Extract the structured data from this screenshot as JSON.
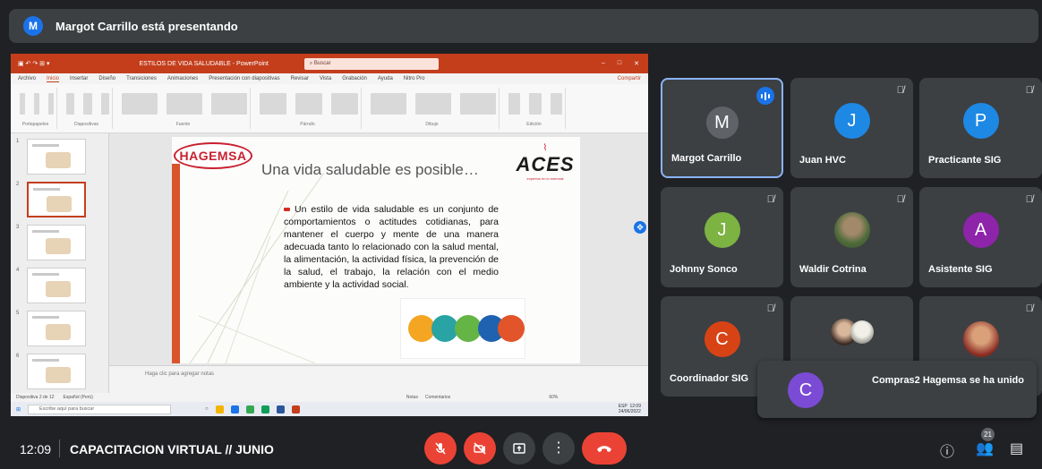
{
  "banner": {
    "avatar_letter": "M",
    "text": "Margot Carrillo está presentando",
    "avatar_color": "#1a73e8"
  },
  "presentation": {
    "window_title": "ESTILOS DE VIDA SALUDABLE - PowerPoint",
    "search_placeholder": "Buscar",
    "tabs": [
      "Archivo",
      "Inicio",
      "Insertar",
      "Diseño",
      "Transiciones",
      "Animaciones",
      "Presentación con diapositivas",
      "Revisar",
      "Vista",
      "Grabación",
      "Ayuda",
      "Nitro Pro"
    ],
    "share_label": "Compartir",
    "ribbon_groups": [
      "Portapapeles",
      "Diapositivas",
      "Fuente",
      "Párrafo",
      "Dibujo",
      "Edición"
    ],
    "thumb_numbers": [
      "1",
      "2",
      "3",
      "4",
      "5",
      "6"
    ],
    "slide": {
      "logo_left": "HAGEMSA",
      "title": "Una vida saludable es posible…",
      "logo_right": "ACES",
      "logo_right_sub": "expertos en lo esencial",
      "bullet": "Un estilo de vida saludable es un conjunto de comportamientos o actitudes cotidianas, para mantener el cuerpo y mente de una manera adecuada tanto lo relacionado con la salud mental, la alimentación, la actividad física, la prevención de la salud, el trabajo, la relación con el medio ambiente y la actividad social."
    },
    "notes_placeholder": "Haga clic para agregar notas",
    "status_left": "Diapositiva 2 de 12",
    "status_lang": "Español (Perú)",
    "status_notes": "Notas",
    "status_comments": "Comentarios",
    "status_zoom": "60%",
    "taskbar_search": "Escribe aquí para buscar",
    "taskbar_time": "12:09",
    "taskbar_date": "24/06/2022",
    "taskbar_lang": "ESP"
  },
  "participants": [
    {
      "name": "Margot Carrillo",
      "letter": "M",
      "color": "#5f6368"
    },
    {
      "name": "Juan HVC",
      "letter": "J",
      "color": "#1e88e5"
    },
    {
      "name": "Practicante SIG",
      "letter": "P",
      "color": "#1e88e5"
    },
    {
      "name": "Johnny Sonco",
      "letter": "J",
      "color": "#7cb342"
    },
    {
      "name": "Waldir Cotrina",
      "letter": "",
      "color": "#6d5a43"
    },
    {
      "name": "Asistente SIG",
      "letter": "A",
      "color": "#8e24aa"
    },
    {
      "name": "Coordinador SIG",
      "letter": "C",
      "color": "#d84315"
    }
  ],
  "toast": {
    "letter": "C",
    "text": "Compras2 Hagemsa se ha unido",
    "color": "#7b4bd6"
  },
  "bottom": {
    "time": "12:09",
    "meeting_name": "CAPACITACION VIRTUAL // JUNIO",
    "participant_count": "21"
  },
  "colors": {
    "accent": "#1a73e8",
    "danger": "#ea4335",
    "tile_bg": "#3c4043",
    "page_bg": "#202124",
    "ppt_red": "#c43e1c"
  }
}
